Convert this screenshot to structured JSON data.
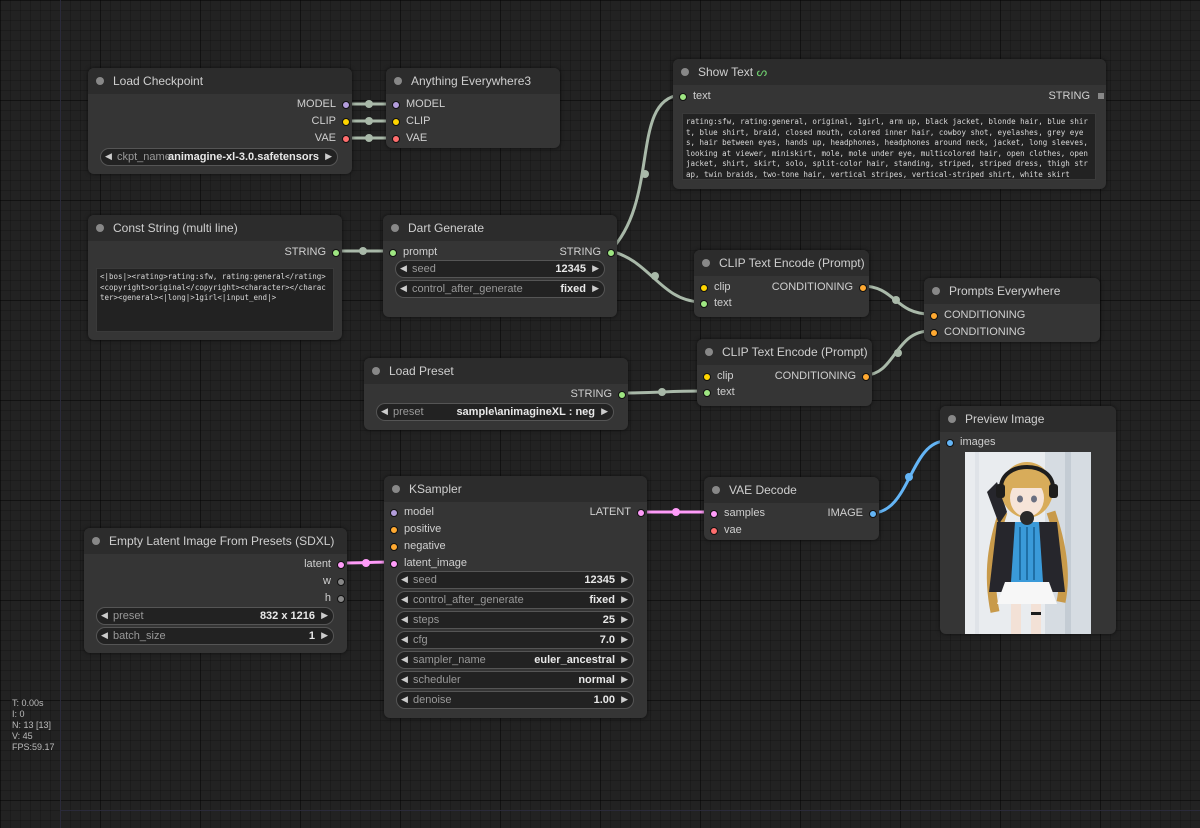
{
  "colors": {
    "model": "#b39ddb",
    "clip": "#ffd500",
    "vae": "#ff6e6e",
    "string": "#9ee682",
    "conditioning": "#ffa931",
    "latent": "#ff9cf9",
    "image": "#64b5f6"
  },
  "nodes": {
    "load_checkpoint": {
      "title": "Load Checkpoint",
      "outputs": [
        "MODEL",
        "CLIP",
        "VAE"
      ],
      "ckpt_label": "ckpt_name",
      "ckpt_value": "animagine-xl-3.0.safetensors"
    },
    "anything_everywhere": {
      "title": "Anything Everywhere3",
      "inputs": [
        "MODEL",
        "CLIP",
        "VAE"
      ]
    },
    "show_text": {
      "title": "Show Text",
      "title_icon": "link-icon",
      "input": "text",
      "output": "STRING",
      "content": "rating:sfw, rating:general, original, 1girl, arm up, black jacket, blonde hair, blue shirt, blue shirt, braid, closed mouth, colored inner hair, cowboy shot, eyelashes, grey eyes, hair between eyes, hands up, headphones, headphones around neck, jacket, long sleeves, looking at viewer, miniskirt, mole, mole under eye, multicolored hair, open clothes, open jacket, shirt, skirt, solo, split-color hair, standing, striped, striped dress, thigh strap, twin braids, two-tone hair, vertical stripes, vertical-striped shirt, white skirt"
    },
    "const_string": {
      "title": "Const String (multi line)",
      "output": "STRING",
      "content": "<|bos|><rating>rating:sfw, rating:general</rating><copyright>original</copyright><character></character><general><|long|>1girl<|input_end|>"
    },
    "dart_generate": {
      "title": "Dart Generate",
      "input": "prompt",
      "output": "STRING",
      "seed_label": "seed",
      "seed_value": "12345",
      "cag_label": "control_after_generate",
      "cag_value": "fixed"
    },
    "clip_encode_pos": {
      "title": "CLIP Text Encode (Prompt)",
      "inputs": [
        "clip",
        "text"
      ],
      "output": "CONDITIONING"
    },
    "prompts_everywhere": {
      "title": "Prompts Everywhere",
      "inputs": [
        "CONDITIONING",
        "CONDITIONING"
      ]
    },
    "load_preset": {
      "title": "Load Preset",
      "output": "STRING",
      "preset_label": "preset",
      "preset_value": "sample\\animagineXL : neg"
    },
    "clip_encode_neg": {
      "title": "CLIP Text Encode (Prompt)",
      "inputs": [
        "clip",
        "text"
      ],
      "output": "CONDITIONING"
    },
    "preview_image": {
      "title": "Preview Image",
      "input": "images"
    },
    "ksampler": {
      "title": "KSampler",
      "inputs": [
        "model",
        "positive",
        "negative",
        "latent_image"
      ],
      "output": "LATENT",
      "widgets": [
        {
          "label": "seed",
          "value": "12345"
        },
        {
          "label": "control_after_generate",
          "value": "fixed"
        },
        {
          "label": "steps",
          "value": "25"
        },
        {
          "label": "cfg",
          "value": "7.0"
        },
        {
          "label": "sampler_name",
          "value": "euler_ancestral"
        },
        {
          "label": "scheduler",
          "value": "normal"
        },
        {
          "label": "denoise",
          "value": "1.00"
        }
      ]
    },
    "vae_decode": {
      "title": "VAE Decode",
      "inputs": [
        "samples",
        "vae"
      ],
      "output": "IMAGE"
    },
    "empty_latent": {
      "title": "Empty Latent Image From Presets (SDXL)",
      "outputs": [
        "latent",
        "w",
        "h"
      ],
      "preset_label": "preset",
      "preset_value": "832 x 1216",
      "batch_label": "batch_size",
      "batch_value": "1"
    }
  },
  "stats": [
    "T: 0.00s",
    "I: 0",
    "N: 13 [13]",
    "V: 45",
    "FPS:59.17"
  ]
}
